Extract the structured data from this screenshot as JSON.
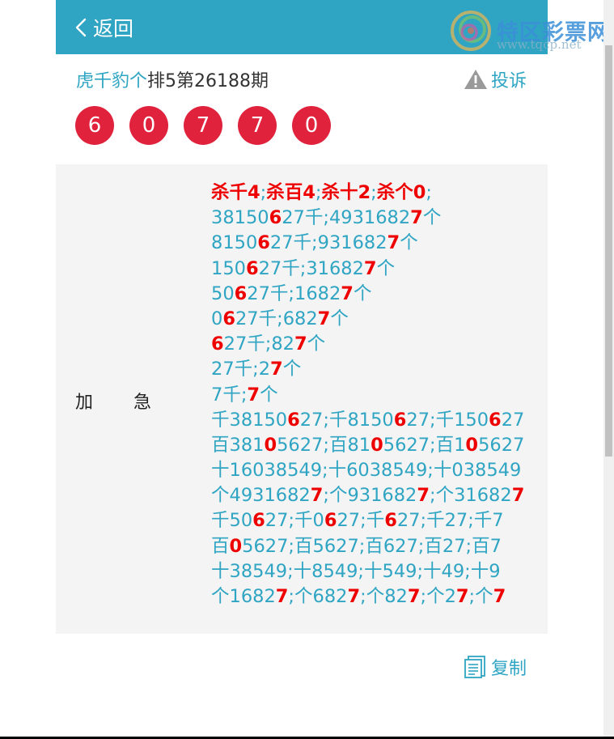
{
  "header": {
    "back_label": "返回",
    "logo_title": "特区彩票网",
    "logo_url": "www.tqcp.net"
  },
  "title": {
    "lottery": "虎千豹个",
    "game": "排5第26188期"
  },
  "complain_label": "投诉",
  "balls": [
    "6",
    "0",
    "7",
    "7",
    "0"
  ],
  "category_label": [
    "加",
    "急"
  ],
  "content_lines": [
    [
      [
        "杀千4",
        "r"
      ],
      [
        ";",
        ""
      ],
      [
        "杀百4",
        "r"
      ],
      [
        ";",
        ""
      ],
      [
        "杀十2",
        "r"
      ],
      [
        ";",
        ""
      ],
      [
        "杀个0",
        "r"
      ],
      [
        ";",
        ""
      ]
    ],
    [
      [
        "38150",
        ""
      ],
      [
        "6",
        "r"
      ],
      [
        "27千;4931682",
        ""
      ],
      [
        "7",
        "r"
      ],
      [
        "个",
        ""
      ]
    ],
    [
      [
        "8150",
        ""
      ],
      [
        "6",
        "r"
      ],
      [
        "27千;931682",
        ""
      ],
      [
        "7",
        "r"
      ],
      [
        "个",
        ""
      ]
    ],
    [
      [
        "150",
        ""
      ],
      [
        "6",
        "r"
      ],
      [
        "27千;31682",
        ""
      ],
      [
        "7",
        "r"
      ],
      [
        "个",
        ""
      ]
    ],
    [
      [
        "50",
        ""
      ],
      [
        "6",
        "r"
      ],
      [
        "27千;1682",
        ""
      ],
      [
        "7",
        "r"
      ],
      [
        "个",
        ""
      ]
    ],
    [
      [
        "0",
        ""
      ],
      [
        "6",
        "r"
      ],
      [
        "27千;682",
        ""
      ],
      [
        "7",
        "r"
      ],
      [
        "个",
        ""
      ]
    ],
    [
      [
        "6",
        "r"
      ],
      [
        "27千;82",
        ""
      ],
      [
        "7",
        "r"
      ],
      [
        "个",
        ""
      ]
    ],
    [
      [
        "27千;2",
        ""
      ],
      [
        "7",
        "r"
      ],
      [
        "个",
        ""
      ]
    ],
    [
      [
        "7千;",
        ""
      ],
      [
        "7",
        "r"
      ],
      [
        "个",
        ""
      ]
    ],
    [
      [
        "千38150",
        ""
      ],
      [
        "6",
        "r"
      ],
      [
        "27;千8150",
        ""
      ],
      [
        "6",
        "r"
      ],
      [
        "27;千150",
        ""
      ],
      [
        "6",
        "r"
      ],
      [
        "27",
        ""
      ]
    ],
    [
      [
        "百381",
        ""
      ],
      [
        "0",
        "r"
      ],
      [
        "5627;百81",
        ""
      ],
      [
        "0",
        "r"
      ],
      [
        "5627;百1",
        ""
      ],
      [
        "0",
        "r"
      ],
      [
        "5627",
        ""
      ]
    ],
    [
      [
        "十16038549;十6038549;十038549",
        ""
      ]
    ],
    [
      [
        "个4931682",
        ""
      ],
      [
        "7",
        "r"
      ],
      [
        ";个931682",
        ""
      ],
      [
        "7",
        "r"
      ],
      [
        ";个31682",
        ""
      ],
      [
        "7",
        "r"
      ]
    ],
    [
      [
        "千50",
        ""
      ],
      [
        "6",
        "r"
      ],
      [
        "27;千0",
        ""
      ],
      [
        "6",
        "r"
      ],
      [
        "27;千",
        ""
      ],
      [
        "6",
        "r"
      ],
      [
        "27;千27;千7",
        ""
      ]
    ],
    [
      [
        "百",
        ""
      ],
      [
        "0",
        "r"
      ],
      [
        "5627;百5627;百627;百27;百7",
        ""
      ]
    ],
    [
      [
        "十38549;十8549;十549;十49;十9",
        ""
      ]
    ],
    [
      [
        "个1682",
        ""
      ],
      [
        "7",
        "r"
      ],
      [
        ";个682",
        ""
      ],
      [
        "7",
        "r"
      ],
      [
        ";个82",
        ""
      ],
      [
        "7",
        "r"
      ],
      [
        ";个2",
        ""
      ],
      [
        "7",
        "r"
      ],
      [
        ";个",
        ""
      ],
      [
        "7",
        "r"
      ]
    ]
  ],
  "copy_label": "复制",
  "colors": {
    "header_bg": "#2fa5c3",
    "ball_bg": "#e0223d",
    "highlight": "#ee0000",
    "text_teal": "#2fa5c3",
    "panel_bg": "#f4f4f4"
  }
}
